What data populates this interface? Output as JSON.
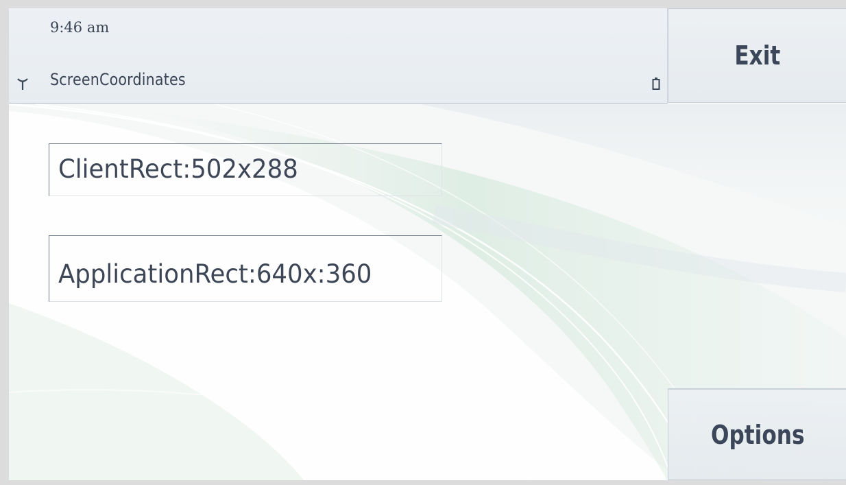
{
  "status_pane": {
    "time": "9:46 am",
    "title": "ScreenCoordinates",
    "signal_icon": "signal-antenna-icon",
    "battery_icon": "battery-icon"
  },
  "softkeys": {
    "exit_label": "Exit",
    "options_label": "Options"
  },
  "content": {
    "client_rect_label": "ClientRect:502x288",
    "application_rect_label": "ApplicationRect:640x:360"
  },
  "colors": {
    "text": "#3a4556",
    "softkey_text": "#3b465a",
    "pane_background": "#e6ebf0",
    "wave_green": "#cfe6d8"
  }
}
